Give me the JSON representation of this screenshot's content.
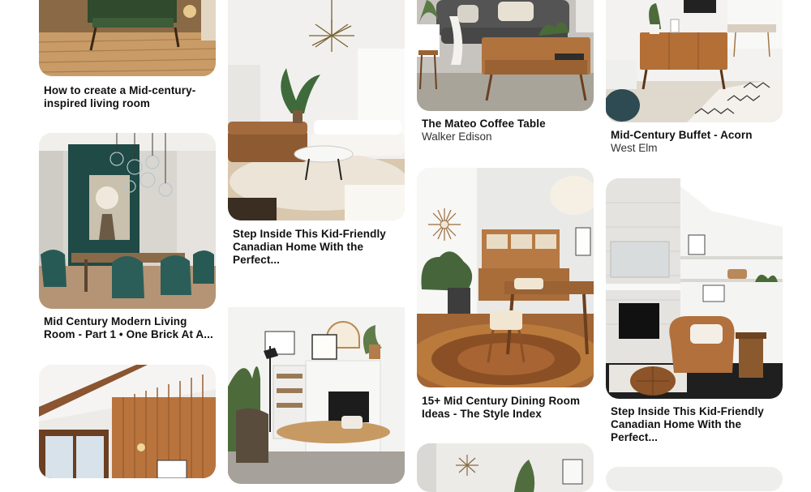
{
  "pins": [
    {
      "title": "How to create a Mid-century-inspired living room",
      "subtitle": ""
    },
    {
      "title": "Mid Century Modern Living Room - Part 1 • One Brick At A...",
      "subtitle": ""
    },
    {
      "title": "",
      "subtitle": ""
    },
    {
      "title": "Step Inside This Kid-Friendly Canadian Home With the Perfect...",
      "subtitle": ""
    },
    {
      "title": "",
      "subtitle": ""
    },
    {
      "title": "The Mateo Coffee Table",
      "subtitle": "Walker Edison"
    },
    {
      "title": "15+ Mid Century Dining Room Ideas - The Style Index",
      "subtitle": ""
    },
    {
      "title": "",
      "subtitle": ""
    },
    {
      "title": "Mid-Century Buffet - Acorn",
      "subtitle": "West Elm"
    },
    {
      "title": "Step Inside This Kid-Friendly Canadian Home With the Perfect...",
      "subtitle": ""
    }
  ]
}
